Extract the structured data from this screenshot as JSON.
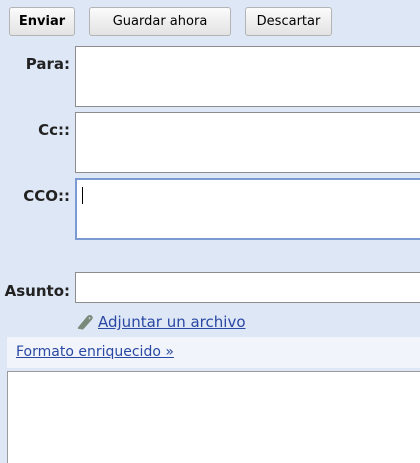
{
  "toolbar": {
    "send_label": "Enviar",
    "save_label": "Guardar ahora",
    "discard_label": "Descartar"
  },
  "fields": {
    "to": {
      "label": "Para:",
      "value": ""
    },
    "cc": {
      "label": "Cc::",
      "value": ""
    },
    "bcc": {
      "label": "CCO::",
      "value": ""
    },
    "subject": {
      "label": "Asunto:",
      "value": ""
    }
  },
  "attach": {
    "label": "Adjuntar un archivo",
    "icon": "paperclip-icon"
  },
  "format": {
    "label": "Formato enriquecido »"
  },
  "body": {
    "value": ""
  },
  "colors": {
    "background": "#dee7f5",
    "link": "#2a48a3",
    "focus_border": "#7b9ad2"
  }
}
